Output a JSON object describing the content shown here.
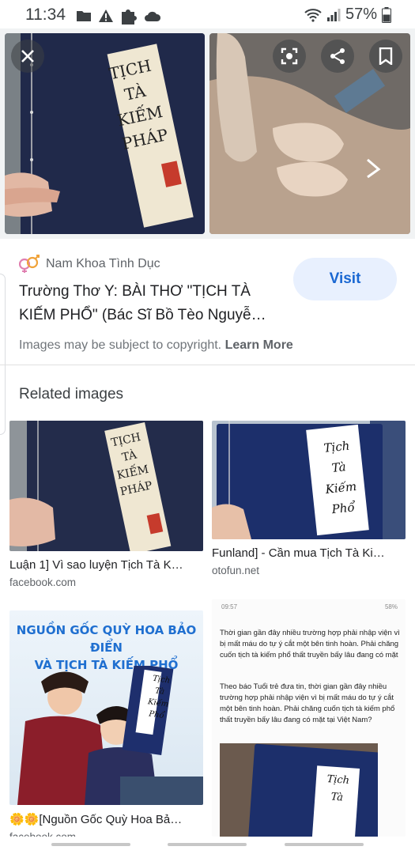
{
  "status_bar": {
    "time": "11:34",
    "battery": "57%"
  },
  "source": {
    "name": "Nam Khoa Tình Dục",
    "title": "Trường Thơ Y: BÀI THƠ \"TỊCH TÀ KIẾM PHỔ\" (Bác Sĩ Bồ Tèo Nguyễ…",
    "visit_label": "Visit",
    "copyright_text": "Images may be subject to copyright.",
    "learn_more": "Learn More"
  },
  "hero": {
    "left_book_text": [
      "TỊCH",
      "TÀ",
      "KIẾM",
      "PHÁP"
    ]
  },
  "related": {
    "heading": "Related images",
    "items": [
      {
        "title": "Luận 1] Vì sao luyện Tịch Tà K…",
        "site": "facebook.com",
        "book_text": [
          "TỊCH",
          "TÀ",
          "KIẾM",
          "PHÁP"
        ]
      },
      {
        "title": "Funland] - Cần mua Tịch Tà Ki…",
        "site": "otofun.net",
        "book_text": [
          "Tịch",
          "Tà",
          "Kiếm",
          "Phổ"
        ]
      },
      {
        "title": "🌼🌼[Nguồn Gốc Quỳ Hoa Bả…",
        "site": "facebook.com",
        "banner_lines": [
          "NGUỒN GỐC QUỲ HOA BẢO ĐIỂN",
          "VÀ TỊCH TÀ KIẾM PHỔ"
        ],
        "book_text": [
          "Tịch",
          "Tà",
          "Kiếm",
          "Phổ"
        ]
      },
      {
        "title": "",
        "site": "",
        "phone_time": "09:57",
        "phone_status": "58%",
        "paragraph_1": "Thời gian gần đây nhiều trường hợp phải nhập viện vì bị mất máu do tự ý cắt một bên tinh hoàn. Phải chăng cuốn tịch tà kiếm phổ thất truyền bấy lâu đang có mặt",
        "paragraph_2": "Theo báo Tuổi trẻ đưa tin, thời gian gần đây nhiều trường hợp phải nhập viện vì bị mất máu do tự ý cắt một bên tinh hoàn. Phải chăng cuốn tịch tà kiếm phổ thất truyền bấy lâu đang có mặt tại Việt Nam?",
        "book_text": [
          "Tịch",
          "Tà"
        ]
      }
    ]
  },
  "colors": {
    "visit_bg": "#e8f0fe",
    "visit_text": "#1967d2",
    "book_blue": "#1f2a44"
  }
}
